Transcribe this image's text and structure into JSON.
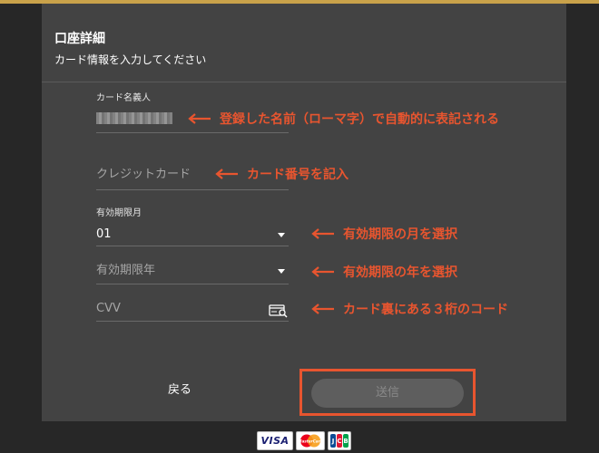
{
  "header": {
    "title": "口座詳細",
    "subtitle": "カード情報を入力してください"
  },
  "form": {
    "cardholder": {
      "label": "カード名義人",
      "value_state": "blurred"
    },
    "card_number": {
      "placeholder": "クレジットカード"
    },
    "expiry_month": {
      "label": "有効期限月",
      "value": "01",
      "icon": "chevron-down-icon"
    },
    "expiry_year": {
      "placeholder": "有効期限年",
      "icon": "chevron-down-icon"
    },
    "cvv": {
      "placeholder": "CVV",
      "icon": "card-search-icon"
    }
  },
  "annotations": {
    "cardholder": "登録した名前（ローマ字）で自動的に表記される",
    "card_number": "カード番号を記入",
    "expiry_month": "有効期限の月を選択",
    "expiry_year": "有効期限の年を選択",
    "cvv": "カード裏にある３桁のコード",
    "color": "#e8552f"
  },
  "actions": {
    "back_label": "戻る",
    "send_label": "送信"
  },
  "card_logos": {
    "visa": "VISA",
    "mastercard": "MasterCard",
    "jcb": [
      "J",
      "C",
      "B"
    ]
  },
  "colors": {
    "page_bg": "#272727",
    "panel_bg": "#434343",
    "accent_line": "#c9a24a",
    "annotation": "#e8552f",
    "send_button_bg": "#5e5e5e"
  }
}
